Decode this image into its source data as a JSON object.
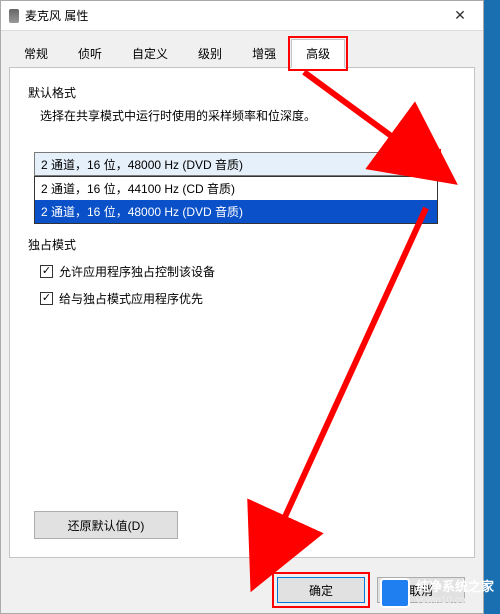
{
  "window": {
    "title": "麦克风 属性"
  },
  "tabs": {
    "items": [
      {
        "label": "常规"
      },
      {
        "label": "侦听"
      },
      {
        "label": "自定义"
      },
      {
        "label": "级别"
      },
      {
        "label": "增强"
      },
      {
        "label": "高级"
      }
    ],
    "active_index": 5
  },
  "default_format": {
    "group_label": "默认格式",
    "desc": "选择在共享模式中运行时使用的采样频率和位深度。",
    "selected": "2 通道，16 位，48000 Hz (DVD 音质)",
    "options": [
      "2 通道，16 位，44100 Hz (CD 音质)",
      "2 通道，16 位，48000 Hz (DVD 音质)"
    ],
    "selected_option_index": 1
  },
  "exclusive_mode": {
    "group_label": "独占模式",
    "check1": {
      "label": "允许应用程序独占控制该设备",
      "checked": true
    },
    "check2": {
      "label": "给与独占模式应用程序优先",
      "checked": true
    }
  },
  "restore_label": "还原默认值(D)",
  "buttons": {
    "ok": "确定",
    "cancel": "取消"
  },
  "watermark": {
    "line1": "纯净系统之家",
    "line2": "ycwin10.com"
  },
  "annotation_color": "#ff0000"
}
